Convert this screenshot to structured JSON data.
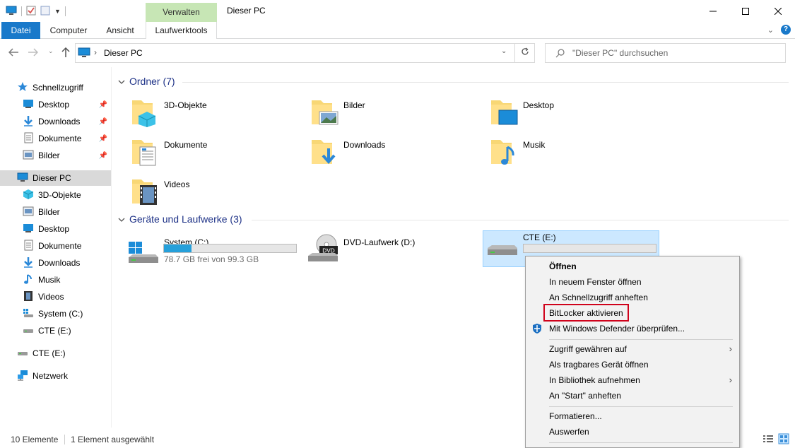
{
  "window": {
    "title": "Dieser PC",
    "context_header": "Verwalten"
  },
  "ribbon": {
    "tabs": [
      "Datei",
      "Computer",
      "Ansicht",
      "Laufwerktools"
    ]
  },
  "address": {
    "path": "Dieser PC",
    "separator": "›"
  },
  "search": {
    "placeholder": "\"Dieser PC\" durchsuchen"
  },
  "sidebar": {
    "quick_access": "Schnellzugriff",
    "quick_items": [
      "Desktop",
      "Downloads",
      "Dokumente",
      "Bilder"
    ],
    "this_pc": "Dieser PC",
    "pc_items": [
      "3D-Objekte",
      "Bilder",
      "Desktop",
      "Dokumente",
      "Downloads",
      "Musik",
      "Videos",
      "System (C:)",
      "CTE (E:)"
    ],
    "drive": "CTE (E:)",
    "network": "Netzwerk"
  },
  "main": {
    "folders_header": "Ordner (7)",
    "folders": [
      "3D-Objekte",
      "Bilder",
      "Desktop",
      "Dokumente",
      "Downloads",
      "Musik",
      "Videos"
    ],
    "devices_header": "Geräte und Laufwerke (3)",
    "drives": [
      {
        "label": "System (C:)",
        "sub": "78.7 GB frei von 99.3 GB",
        "used_fraction": 0.207
      },
      {
        "label": "DVD-Laufwerk (D:)",
        "badge": "DVD"
      },
      {
        "label": "CTE (E:)",
        "used_fraction": 0.0
      }
    ]
  },
  "context_menu": {
    "items": [
      "Öffnen",
      "In neuem Fenster öffnen",
      "An Schnellzugriff anheften",
      "BitLocker aktivieren",
      "Mit Windows Defender überprüfen...",
      "Zugriff gewähren auf",
      "Als tragbares Gerät öffnen",
      "In Bibliothek aufnehmen",
      "An \"Start\" anheften",
      "Formatieren...",
      "Auswerfen"
    ]
  },
  "status": {
    "count": "10 Elemente",
    "selected": "1 Element ausgewählt"
  },
  "colors": {
    "accent": "#1979ca",
    "selection": "#cce8ff",
    "highlight": "#d0021b",
    "header_text": "#1e3287"
  }
}
